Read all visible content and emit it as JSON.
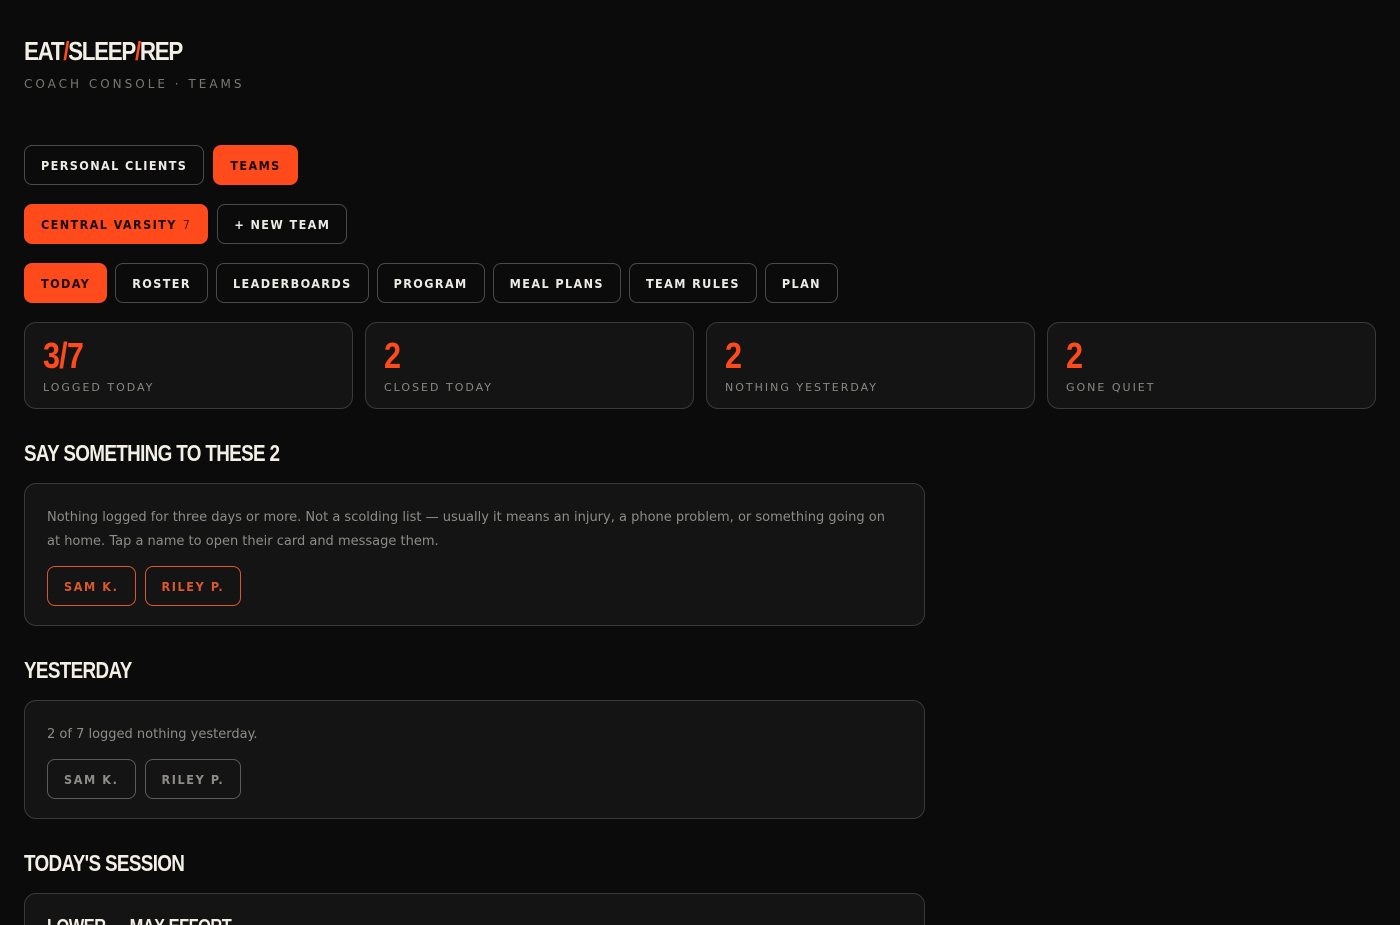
{
  "brand": {
    "part1": "EAT",
    "slash1": "/",
    "part2": "SLEEP",
    "slash2": "/",
    "part3": "REP"
  },
  "subtitle": "COACH CONSOLE · TEAMS",
  "mode_tabs": [
    {
      "label": "PERSONAL CLIENTS",
      "active": false
    },
    {
      "label": "TEAMS",
      "active": true
    }
  ],
  "team_selector": {
    "name": "CENTRAL VARSITY",
    "count": "7",
    "new_team_label": "+ NEW TEAM"
  },
  "section_tabs": [
    {
      "label": "TODAY",
      "active": true
    },
    {
      "label": "ROSTER",
      "active": false
    },
    {
      "label": "LEADERBOARDS",
      "active": false
    },
    {
      "label": "PROGRAM",
      "active": false
    },
    {
      "label": "MEAL PLANS",
      "active": false
    },
    {
      "label": "TEAM RULES",
      "active": false
    },
    {
      "label": "PLAN",
      "active": false
    }
  ],
  "stats": [
    {
      "value": "3/7",
      "label": "LOGGED TODAY"
    },
    {
      "value": "2",
      "label": "CLOSED TODAY"
    },
    {
      "value": "2",
      "label": "NOTHING YESTERDAY"
    },
    {
      "value": "2",
      "label": "GONE QUIET"
    }
  ],
  "gone_quiet": {
    "title": "SAY SOMETHING TO THESE 2",
    "description": "Nothing logged for three days or more. Not a scolding list — usually it means an injury, a phone problem, or something going on at home. Tap a name to open their card and message them.",
    "names": [
      "SAM K.",
      "RILEY P."
    ]
  },
  "yesterday": {
    "title": "YESTERDAY",
    "description": "2 of 7 logged nothing yesterday.",
    "names": [
      "SAM K.",
      "RILEY P."
    ]
  },
  "todays_session": {
    "title": "TODAY'S SESSION",
    "session_name": "LOWER — MAX EFFORT"
  },
  "colors": {
    "accent": "#ff4a1c",
    "background": "#0b0b0b",
    "card": "#141414"
  }
}
